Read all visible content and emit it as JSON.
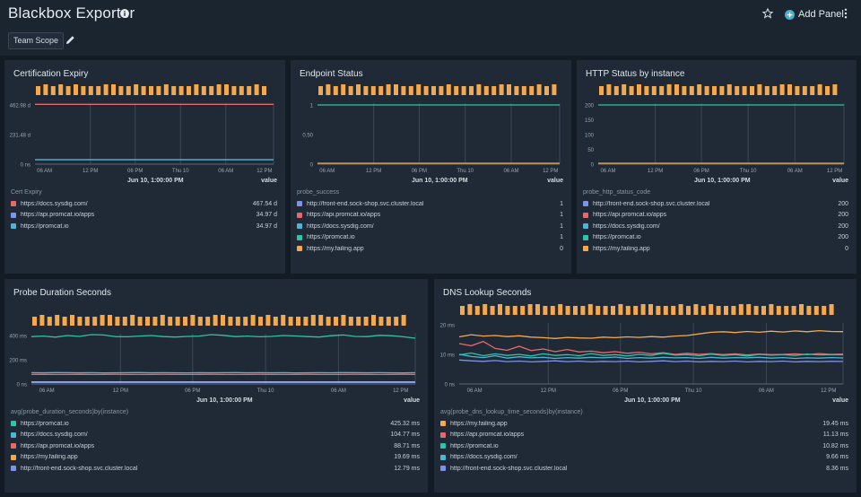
{
  "header": {
    "title": "Blackbox Exporter",
    "add_panel_label": "Add Panel",
    "scope_label": "Team Scope"
  },
  "colors": {
    "orange": "#f5a94c",
    "red": "#e8696b",
    "teal": "#2ec4a8",
    "cyan": "#4eb6d3",
    "blue": "#7c93e8",
    "bg": "#1f2a36"
  },
  "panels": [
    {
      "title": "Certification Expiry",
      "timestamp": "Jun 10, 1:00:00 PM",
      "value_header": "value",
      "legend_header": "Cert Expiry",
      "legend": [
        {
          "label": "https://docs.sysdig.com/",
          "value": "467.54 d",
          "color": "#e8696b"
        },
        {
          "label": "https://api.promcat.io/apps",
          "value": "34.97 d",
          "color": "#7c93e8"
        },
        {
          "label": "https://promcat.io",
          "value": "34.97 d",
          "color": "#4eb6d3"
        }
      ]
    },
    {
      "title": "Endpoint Status",
      "timestamp": "Jun 10, 1:00:00 PM",
      "value_header": "value",
      "legend_header": "probe_success",
      "legend": [
        {
          "label": "http://front-end.sock-shop.svc.cluster.local",
          "value": "1",
          "color": "#7c93e8"
        },
        {
          "label": "https://api.promcat.io/apps",
          "value": "1",
          "color": "#e8696b"
        },
        {
          "label": "https://docs.sysdig.com/",
          "value": "1",
          "color": "#4eb6d3"
        },
        {
          "label": "https://promcat.io",
          "value": "1",
          "color": "#2ec4a8"
        },
        {
          "label": "https://my.failing.app",
          "value": "0",
          "color": "#f5a94c"
        }
      ]
    },
    {
      "title": "HTTP Status by instance",
      "timestamp": "Jun 10, 1:00:00 PM",
      "value_header": "value",
      "legend_header": "probe_http_status_code",
      "legend": [
        {
          "label": "http://front-end.sock-shop.svc.cluster.local",
          "value": "200",
          "color": "#7c93e8"
        },
        {
          "label": "https://api.promcat.io/apps",
          "value": "200",
          "color": "#e8696b"
        },
        {
          "label": "https://docs.sysdig.com/",
          "value": "200",
          "color": "#4eb6d3"
        },
        {
          "label": "https://promcat.io",
          "value": "200",
          "color": "#2ec4a8"
        },
        {
          "label": "https://my.failing.app",
          "value": "0",
          "color": "#f5a94c"
        }
      ]
    },
    {
      "title": "Probe Duration Seconds",
      "timestamp": "Jun 10, 1:00:00 PM",
      "value_header": "value",
      "legend_header": "avg(probe_duration_seconds)by(instance)",
      "legend": [
        {
          "label": "https://promcat.io",
          "value": "425.32 ms",
          "color": "#2ec4a8"
        },
        {
          "label": "https://docs.sysdig.com/",
          "value": "104.77 ms",
          "color": "#4eb6d3"
        },
        {
          "label": "https://api.promcat.io/apps",
          "value": "88.71 ms",
          "color": "#e8696b"
        },
        {
          "label": "https://my.failing.app",
          "value": "19.69 ms",
          "color": "#f5a94c"
        },
        {
          "label": "http://front-end.sock-shop.svc.cluster.local",
          "value": "12.79 ms",
          "color": "#7c93e8"
        }
      ]
    },
    {
      "title": "DNS Lookup Seconds",
      "timestamp": "Jun 10, 1:00:00 PM",
      "value_header": "value",
      "legend_header": "avg(probe_dns_lookup_time_seconds)by(instance)",
      "legend": [
        {
          "label": "https://my.failing.app",
          "value": "19.45 ms",
          "color": "#f5a94c"
        },
        {
          "label": "https://api.promcat.io/apps",
          "value": "11.13 ms",
          "color": "#e8696b"
        },
        {
          "label": "https://promcat.io",
          "value": "10.82 ms",
          "color": "#2ec4a8"
        },
        {
          "label": "https://docs.sysdig.com/",
          "value": "9.66 ms",
          "color": "#4eb6d3"
        },
        {
          "label": "http://front-end.sock-shop.svc.cluster.local",
          "value": "8.36 ms",
          "color": "#7c93e8"
        }
      ]
    }
  ],
  "chart_data": [
    {
      "type": "line",
      "title": "Certification Expiry",
      "y_ticks": [
        "462.98 d",
        "231.48 d",
        "0 ns"
      ],
      "ylim": [
        0,
        462.98
      ],
      "x_ticks": [
        "06 AM",
        "12 PM",
        "06 PM",
        "Thu 10",
        "06 AM",
        "12 PM"
      ],
      "series": [
        {
          "name": "https://docs.sysdig.com/",
          "color": "#e8696b",
          "values": [
            467.54,
            467.54
          ]
        },
        {
          "name": "https://api.promcat.io/apps",
          "color": "#7c93e8",
          "values": [
            34.97,
            34.97
          ]
        },
        {
          "name": "https://promcat.io",
          "color": "#4eb6d3",
          "values": [
            34.97,
            34.97
          ]
        }
      ]
    },
    {
      "type": "line",
      "title": "Endpoint Status",
      "y_ticks": [
        "1",
        "0.50",
        "0"
      ],
      "ylim": [
        0,
        1
      ],
      "x_ticks": [
        "06 AM",
        "12 PM",
        "06 PM",
        "Thu 10",
        "06 AM",
        "12 PM"
      ],
      "series": [
        {
          "name": "https://promcat.io",
          "color": "#2ec4a8",
          "values": [
            1,
            1
          ]
        },
        {
          "name": "https://my.failing.app",
          "color": "#f5a94c",
          "values": [
            0,
            0
          ]
        }
      ]
    },
    {
      "type": "line",
      "title": "HTTP Status by instance",
      "y_ticks": [
        "200",
        "150",
        "100",
        "50",
        "0"
      ],
      "ylim": [
        0,
        200
      ],
      "x_ticks": [
        "06 AM",
        "12 PM",
        "06 PM",
        "Thu 10",
        "06 AM",
        "12 PM"
      ],
      "series": [
        {
          "name": "https://promcat.io",
          "color": "#2ec4a8",
          "values": [
            200,
            200
          ]
        },
        {
          "name": "https://my.failing.app",
          "color": "#f5a94c",
          "values": [
            0,
            0
          ]
        }
      ]
    },
    {
      "type": "line",
      "title": "Probe Duration Seconds",
      "y_ticks": [
        "400 ms",
        "200 ms",
        "0 ns"
      ],
      "ylim": [
        0,
        450
      ],
      "x_ticks": [
        "06 AM",
        "12 PM",
        "06 PM",
        "Thu 10",
        "06 AM",
        "12 PM"
      ],
      "series": [
        {
          "name": "https://promcat.io",
          "color": "#2ec4a8",
          "values": [
            440,
            445,
            435,
            450,
            442,
            470,
            455,
            440,
            438,
            445,
            450,
            440,
            436,
            442,
            445,
            460,
            452,
            440,
            445,
            438,
            442,
            450,
            446,
            440,
            436,
            448,
            455,
            442,
            440,
            452,
            448,
            438,
            425
          ]
        },
        {
          "name": "https://docs.sysdig.com/",
          "color": "#4eb6d3",
          "values": [
            105,
            104,
            106,
            105,
            104,
            105,
            103,
            104,
            105,
            106,
            104,
            105,
            104,
            103,
            105,
            104,
            105,
            106,
            104,
            105,
            104,
            105,
            103,
            104,
            105,
            104,
            106,
            105,
            104,
            105,
            104,
            103,
            105
          ]
        },
        {
          "name": "https://api.promcat.io/apps",
          "color": "#e8696b",
          "values": [
            89,
            90,
            88,
            89,
            90,
            88,
            89,
            90,
            89,
            88,
            89,
            90,
            89,
            88,
            89,
            90,
            89,
            88,
            89,
            90,
            89,
            88,
            89,
            90,
            89,
            88,
            89,
            90,
            89,
            88,
            89,
            90,
            89
          ]
        },
        {
          "name": "https://my.failing.app",
          "color": "#f5a94c",
          "values": [
            20,
            20,
            20,
            20,
            20,
            20,
            20,
            20,
            20,
            20,
            20,
            20,
            20,
            20,
            20,
            20,
            20,
            20,
            20,
            20,
            20,
            20,
            20,
            20,
            20,
            20,
            20,
            20,
            20,
            20,
            20,
            20,
            20
          ]
        },
        {
          "name": "http://front-end.sock-shop.svc.cluster.local",
          "color": "#7c93e8",
          "values": [
            13,
            13,
            13,
            13,
            13,
            13,
            13,
            13,
            13,
            13,
            13,
            13,
            13,
            13,
            13,
            13,
            13,
            13,
            13,
            13,
            13,
            13,
            13,
            13,
            13,
            13,
            13,
            13,
            13,
            13,
            13,
            13,
            13
          ]
        }
      ]
    },
    {
      "type": "line",
      "title": "DNS Lookup Seconds",
      "y_ticks": [
        "20 ms",
        "10 ms",
        "0 ns"
      ],
      "ylim": [
        0,
        22
      ],
      "x_ticks": [
        "06 AM",
        "12 PM",
        "06 PM",
        "Thu 10",
        "06 AM",
        "12 PM"
      ],
      "series": [
        {
          "name": "https://my.failing.app",
          "color": "#f5a94c",
          "values": [
            17.5,
            18.3,
            17.8,
            18.0,
            17.6,
            17.9,
            17.4,
            17.2,
            16.9,
            17.3,
            17.1,
            17.0,
            17.4,
            17.2,
            17.5,
            17.3,
            17.6,
            17.4,
            17.8,
            18.0,
            18.6,
            19.2,
            19.4,
            19.1,
            19.5,
            19.2,
            19.6,
            19.3,
            19.7,
            19.4,
            19.8,
            19.5,
            19.45
          ]
        },
        {
          "name": "https://api.promcat.io/apps",
          "color": "#e8696b",
          "values": [
            15.0,
            14.2,
            15.8,
            13.2,
            12.5,
            14.0,
            12.4,
            13.0,
            12.0,
            12.8,
            11.9,
            12.2,
            11.6,
            12.0,
            11.4,
            11.8,
            11.2,
            11.6,
            11.0,
            11.4,
            11.0,
            11.3,
            10.9,
            11.2,
            10.8,
            11.1,
            10.9,
            11.0,
            11.2,
            10.9,
            11.3,
            11.0,
            11.13
          ]
        },
        {
          "name": "https://promcat.io",
          "color": "#2ec4a8",
          "values": [
            10.8,
            11.5,
            10.5,
            11.2,
            10.6,
            11.0,
            10.4,
            11.2,
            10.6,
            10.9,
            10.5,
            11.3,
            10.6,
            10.9,
            10.4,
            11.0,
            10.6,
            11.4,
            10.7,
            10.9,
            10.5,
            11.1,
            10.6,
            10.9,
            10.4,
            11.0,
            10.7,
            10.9,
            10.6,
            11.1,
            10.8,
            10.9,
            10.82
          ]
        },
        {
          "name": "https://docs.sysdig.com/",
          "color": "#4eb6d3",
          "values": [
            11.0,
            10.2,
            9.8,
            10.5,
            9.6,
            10.1,
            9.7,
            9.9,
            9.5,
            9.8,
            9.6,
            9.9,
            9.7,
            10.0,
            9.5,
            9.8,
            9.6,
            9.9,
            9.7,
            9.8,
            9.5,
            9.9,
            9.6,
            9.8,
            9.7,
            9.9,
            9.6,
            9.8,
            9.5,
            9.7,
            9.6,
            9.8,
            9.66
          ]
        },
        {
          "name": "http://front-end.sock-shop.svc.cluster.local",
          "color": "#7c93e8",
          "values": [
            8.9,
            8.6,
            8.4,
            8.7,
            8.3,
            8.5,
            8.2,
            8.4,
            8.6,
            8.3,
            8.5,
            8.2,
            8.4,
            8.3,
            8.5,
            8.2,
            8.4,
            8.6,
            8.3,
            8.5,
            8.2,
            8.4,
            8.3,
            8.5,
            8.2,
            8.4,
            8.3,
            8.5,
            8.2,
            8.4,
            8.3,
            8.4,
            8.36
          ]
        }
      ]
    }
  ]
}
